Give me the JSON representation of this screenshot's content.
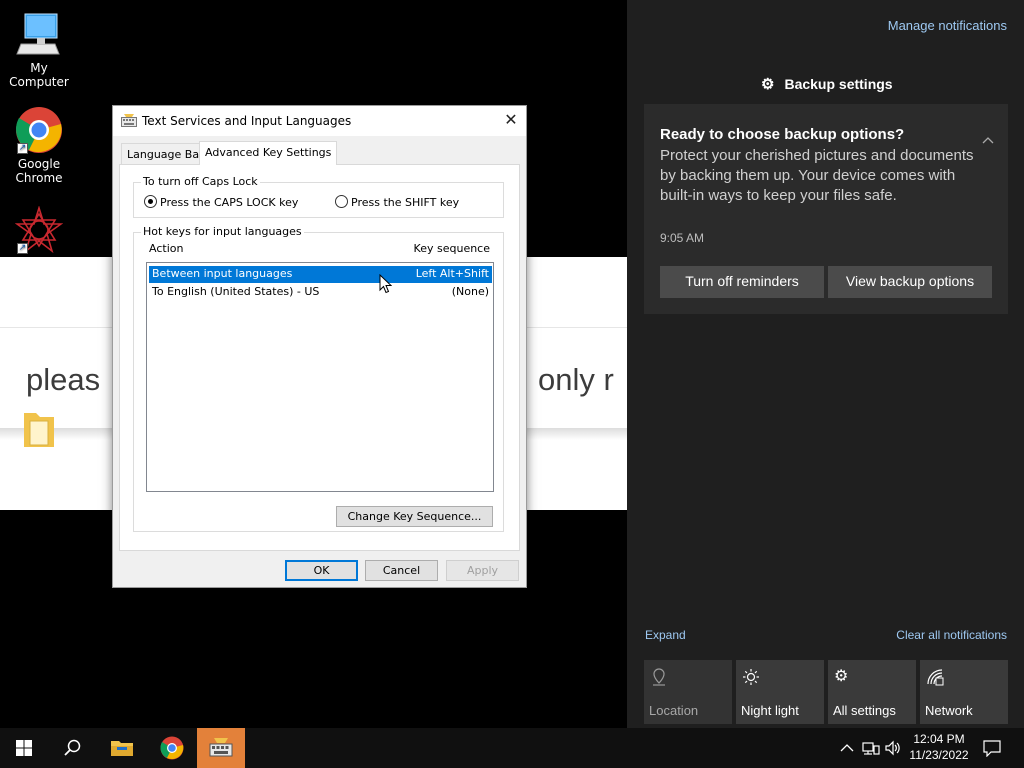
{
  "desktop": {
    "icons": [
      {
        "label": "My Computer"
      },
      {
        "label": "Google Chrome"
      },
      {
        "label": ""
      }
    ]
  },
  "background_window": {
    "text_left": "pleas",
    "text_right": "only r"
  },
  "dialog": {
    "title": "Text Services and Input Languages",
    "tabs": [
      {
        "label": "Language Bar",
        "active": false
      },
      {
        "label": "Advanced Key Settings",
        "active": true
      }
    ],
    "caps_lock": {
      "legend": "To turn off Caps Lock",
      "options": [
        {
          "label": "Press the CAPS LOCK key",
          "checked": true
        },
        {
          "label": "Press the SHIFT key",
          "checked": false
        }
      ]
    },
    "hotkeys": {
      "legend": "Hot keys for input languages",
      "columns": [
        "Action",
        "Key sequence"
      ],
      "rows": [
        {
          "action": "Between input languages",
          "sequence": "Left Alt+Shift",
          "selected": true
        },
        {
          "action": "To English (United States) - US",
          "sequence": "(None)",
          "selected": false
        }
      ],
      "change_button": "Change Key Sequence..."
    },
    "buttons": {
      "ok": "OK",
      "cancel": "Cancel",
      "apply": "Apply"
    }
  },
  "action_center": {
    "manage": "Manage notifications",
    "app_name": "Backup settings",
    "toast": {
      "title": "Ready to choose backup options?",
      "body": "Protect your cherished pictures and documents by backing them up. Your device comes with built-in ways to keep your files safe.",
      "time": "9:05 AM",
      "buttons": [
        "Turn off reminders",
        "View backup options"
      ]
    },
    "expand": "Expand",
    "clear": "Clear all notifications",
    "quick_actions": [
      {
        "label": "Location",
        "icon": "location-icon"
      },
      {
        "label": "Night light",
        "icon": "night-light-icon"
      },
      {
        "label": "All settings",
        "icon": "gear-icon"
      },
      {
        "label": "Network",
        "icon": "network-icon"
      }
    ]
  },
  "taskbar": {
    "time": "12:04 PM",
    "date": "11/23/2022"
  },
  "colors": {
    "selection": "#0078d7",
    "active_taskbar": "#e3813a",
    "link": "#9ec9f2"
  }
}
